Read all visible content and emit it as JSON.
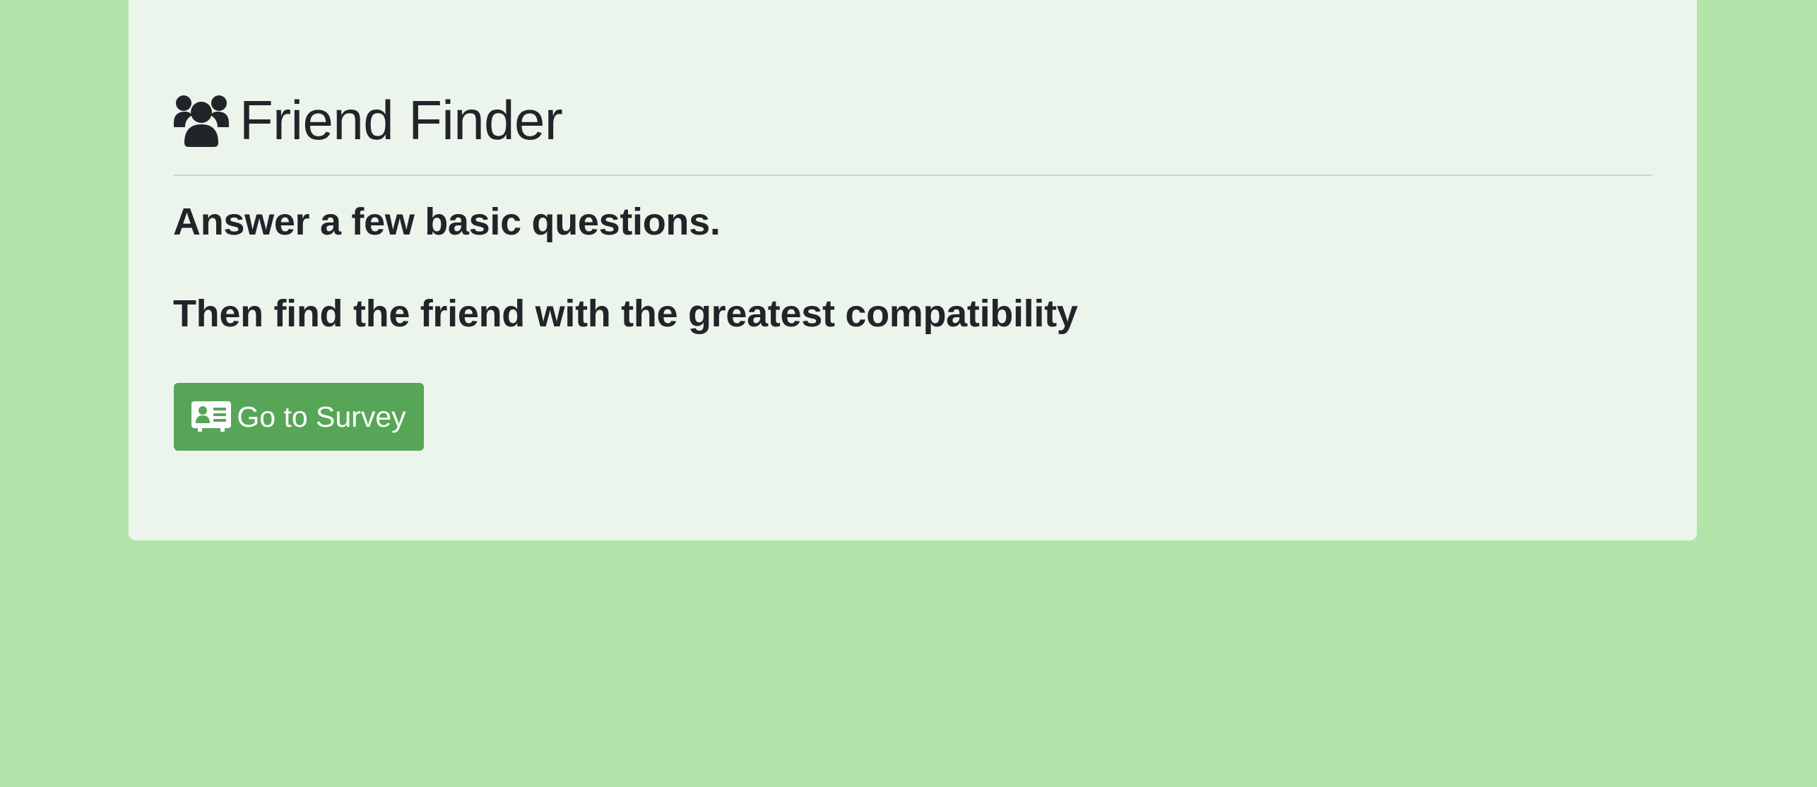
{
  "page": {
    "background_color": "#b2e4aa",
    "panel_color": "#ecf5eb"
  },
  "header": {
    "icon": "users-icon",
    "title": "Friend Finder"
  },
  "intro": {
    "line1": "Answer a few basic questions.",
    "line2": "Then find the friend with the greatest compatibility"
  },
  "survey_button": {
    "icon": "id-card-icon",
    "label": "Go to Survey",
    "color": "#57a657"
  }
}
